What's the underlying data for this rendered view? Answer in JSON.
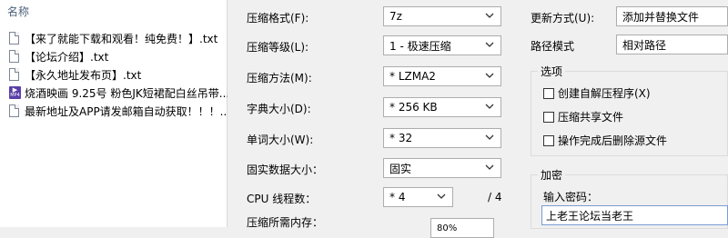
{
  "file_list": {
    "column_header": "名称",
    "files": [
      {
        "name": "【来了就能下载和观看！纯免费！】.txt",
        "type": "txt"
      },
      {
        "name": "【论坛介绍】.txt",
        "type": "txt"
      },
      {
        "name": "【永久地址发布页】.txt",
        "type": "txt"
      },
      {
        "name": "烧酒映画 9.25号 粉色JK短裙配白丝吊带...",
        "type": "mp4",
        "icon_text": "MP4"
      },
      {
        "name": "最新地址及APP请发邮箱自动获取！！！...",
        "type": "txt"
      }
    ]
  },
  "settings": {
    "format": {
      "label": "压缩格式(F):",
      "value": "7z"
    },
    "level": {
      "label": "压缩等级(L):",
      "value": "1 - 极速压缩"
    },
    "method": {
      "label": "压缩方法(M):",
      "value": "* LZMA2"
    },
    "dict_size": {
      "label": "字典大小(D):",
      "value": "* 256 KB"
    },
    "word_size": {
      "label": "单词大小(W):",
      "value": "* 32"
    },
    "solid_size": {
      "label": "固实数据大小：",
      "value": "固实"
    },
    "cpu_threads": {
      "label": "CPU 线程数：",
      "value": "* 4",
      "max": "/ 4"
    },
    "memory": {
      "label": "压缩所需内存：",
      "value": "80%"
    }
  },
  "update": {
    "label": "更新方式(U):",
    "value": "添加并替换文件",
    "path_label": "路径模式",
    "path_value": "相对路径"
  },
  "options": {
    "title": "选项",
    "items": [
      {
        "label": "创建自解压程序(X)",
        "checked": false
      },
      {
        "label": "压缩共享文件",
        "checked": false
      },
      {
        "label": "操作完成后删除源文件",
        "checked": false
      }
    ]
  },
  "encryption": {
    "title": "加密",
    "password_label": "输入密码：",
    "password_value": "上老王论坛当老王"
  }
}
